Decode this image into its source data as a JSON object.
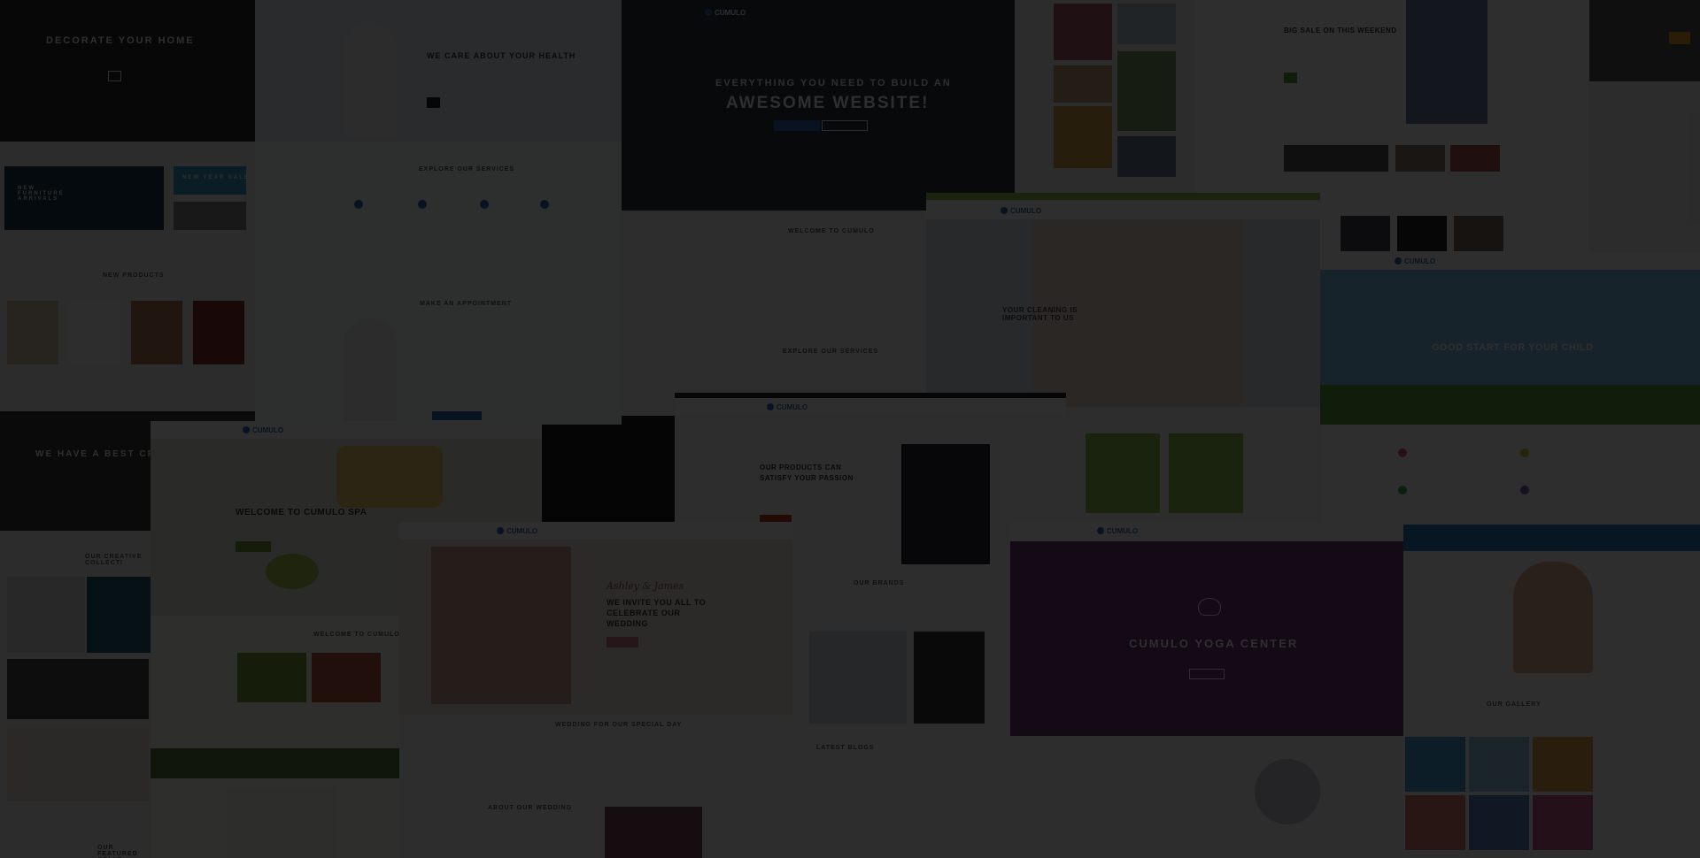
{
  "mockups": {
    "decor": {
      "hero_title": "DECORATE YOUR HOME",
      "promo_left": "NEW FURNITURE ARRIVALS",
      "promo_right_1": "NEW YEAR SALE",
      "section": "NEW PRODUCTS",
      "bottom_banner": "WE HAVE A BEST CREATI",
      "collection": "OUR CREATIVE COLLECTI",
      "featured": "OUR FEATURED COLLE"
    },
    "medical": {
      "hero_title": "WE CARE ABOUT YOUR HEALTH",
      "services": "EXPLORE OUR SERVICES",
      "appointment": "MAKE AN APPOINTMENT"
    },
    "business": {
      "logo": "CUMULO",
      "hero_line1": "EVERYTHING YOU NEED TO BUILD AN",
      "hero_line2": "AWESOME WEBSITE!",
      "welcome": "WELCOME TO CUMULO",
      "services": "EXPLORE OUR SERVICES"
    },
    "cleaning": {
      "logo": "CUMULO",
      "hero_text": "YOUR CLEANING IS IMPORTANT TO US"
    },
    "fashion": {
      "hero_title": "BIG SALE ON THIS WEEKEND"
    },
    "kids": {
      "logo": "CUMULO",
      "hero_text": "GOOD START FOR YOUR CHILD",
      "gallery": "OUR GALLERY"
    },
    "spa": {
      "logo": "CUMULO",
      "hero_text": "WELCOME TO CUMULO SPA",
      "welcome": "WELCOME TO CUMULO SPA"
    },
    "shop": {
      "logo": "CUMULO",
      "hero_line1": "OUR PRODUCTS CAN",
      "hero_line2": "SATISFY YOUR PASSION",
      "brands": "OUR BRANDS",
      "latest": "LATEST BLOGS"
    },
    "wedding": {
      "logo": "CUMULO",
      "script": "Ashley & James",
      "hero_line1": "WE INVITE YOU ALL TO",
      "hero_line2": "CELEBRATE OUR",
      "hero_line3": "WEDDING",
      "section": "WEDDING FOR OUR SPECIAL DAY",
      "about": "ABOUT OUR WEDDING"
    },
    "yoga": {
      "logo": "CUMULO",
      "hero_title": "CUMULO YOGA CENTER"
    }
  },
  "colors": {
    "overlay": "#000000",
    "brand_blue": "#2b6cb0",
    "yoga_purple": "#6b3a7a",
    "kids_green": "#5aa33f",
    "cleaning_green": "#8bc34a",
    "shop_red": "#c0392b"
  }
}
